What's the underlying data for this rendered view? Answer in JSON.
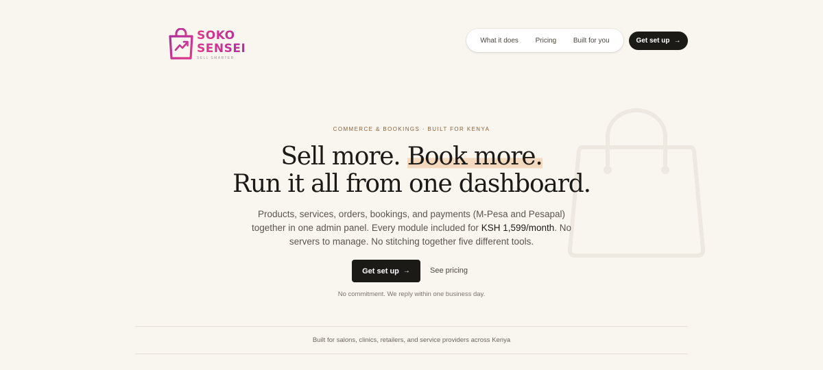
{
  "brand": {
    "line1": "SOKO",
    "line2": "SENSEI",
    "tagline": "SELL SMARTER",
    "gradient_start": "#e0378a",
    "gradient_end": "#b0309c"
  },
  "nav": {
    "links": [
      "What it does",
      "Pricing",
      "Built for you"
    ],
    "cta_label": "Get set up",
    "cta_icon": "arrow-right-icon"
  },
  "hero": {
    "eyebrow": "COMMERCE & BOOKINGS · BUILT FOR KENYA",
    "headline_part1": "Sell more. ",
    "headline_highlight": "Book more.",
    "headline_line2": "Run it all from one dashboard.",
    "sub_before": "Products, services, orders, bookings, and payments (M-Pesa and Pesapal) together in one admin panel. Every module included for ",
    "sub_price": "KSH 1,599/month",
    "sub_after": ". No servers to manage. No stitching together five different tools.",
    "primary_cta": "Get set up",
    "secondary_cta": "See pricing",
    "fineprint": "No commitment. We reply within one business day.",
    "highlight_color": "#f2d9bf"
  },
  "trust": {
    "text": "Built for salons, clinics, retailers, and service providers across Kenya"
  },
  "colors": {
    "background": "#f9f6f0",
    "ink": "#1c1a17",
    "accent": "#8b5e34"
  }
}
